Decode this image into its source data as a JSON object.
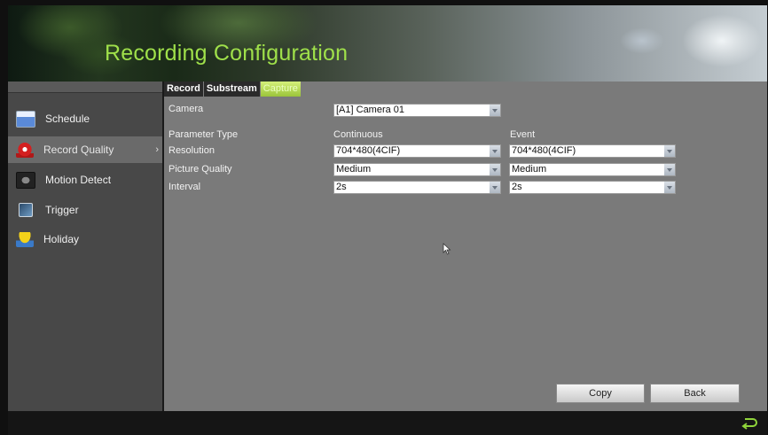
{
  "header": {
    "title": "Recording Configuration"
  },
  "sidebar": {
    "items": [
      {
        "label": "Schedule",
        "icon": "calendar-icon"
      },
      {
        "label": "Record Quality",
        "icon": "record-icon",
        "active": true
      },
      {
        "label": "Motion Detect",
        "icon": "motion-icon"
      },
      {
        "label": "Trigger",
        "icon": "trigger-icon"
      },
      {
        "label": "Holiday",
        "icon": "holiday-icon"
      }
    ]
  },
  "tabs": [
    {
      "label": "Record"
    },
    {
      "label": "Substream"
    },
    {
      "label": "Capture",
      "active": true
    }
  ],
  "form": {
    "camera_label": "Camera",
    "camera_value": "[A1] Camera 01",
    "param_type_label": "Parameter Type",
    "col_continuous": "Continuous",
    "col_event": "Event",
    "resolution_label": "Resolution",
    "resolution_continuous": "704*480(4CIF)",
    "resolution_event": "704*480(4CIF)",
    "quality_label": "Picture Quality",
    "quality_continuous": "Medium",
    "quality_event": "Medium",
    "interval_label": "Interval",
    "interval_continuous": "2s",
    "interval_event": "2s"
  },
  "buttons": {
    "copy": "Copy",
    "back": "Back"
  },
  "colors": {
    "title": "#9fe04a",
    "tab_active": "#b5d956"
  }
}
